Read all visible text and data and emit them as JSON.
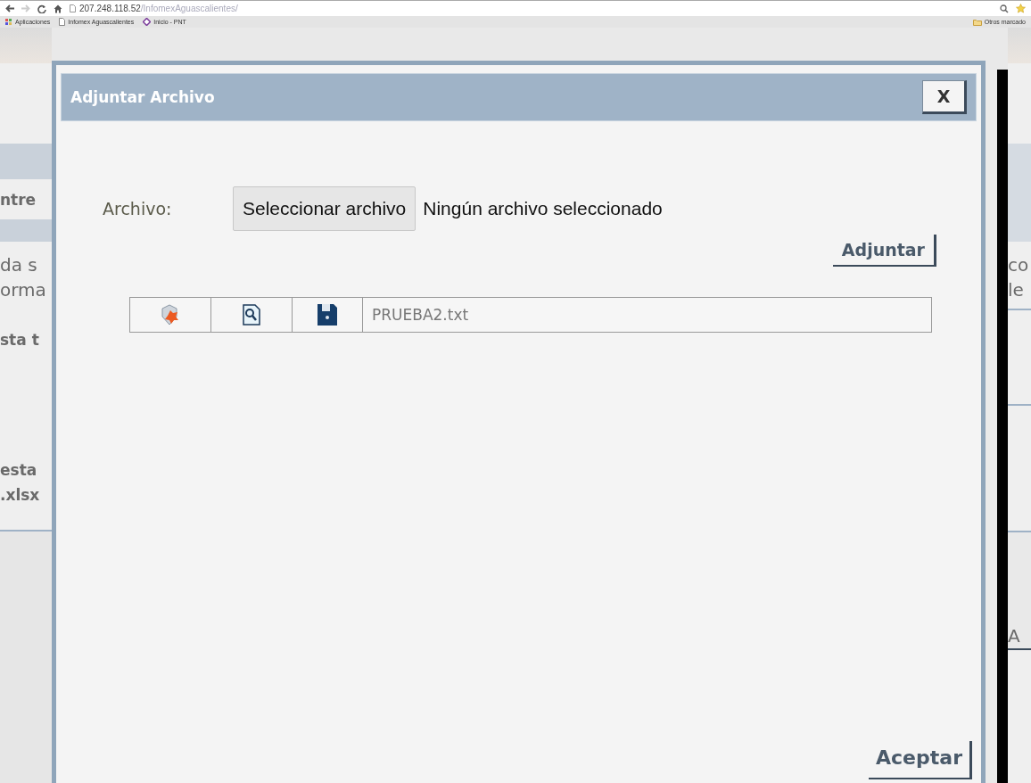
{
  "browser": {
    "url_host": "207.248.118.52",
    "url_path": "/InfomexAguascalientes/",
    "bookmarks": [
      {
        "label": "Aplicaciones",
        "kind": "apps"
      },
      {
        "label": "Infomex Aguascalientes",
        "kind": "page"
      },
      {
        "label": "Inicio - PNT",
        "kind": "site"
      }
    ],
    "other_bookmarks": "Otros marcado"
  },
  "background_page": {
    "left_fragments": [
      {
        "text": "ntre",
        "kind": "heading"
      },
      {
        "text": "da s",
        "kind": "body"
      },
      {
        "text": "orma",
        "kind": "body"
      },
      {
        "text": "sta t",
        "kind": "heading"
      },
      {
        "text": "esta",
        "kind": "heading"
      },
      {
        "text": ".xlsx",
        "kind": "heading"
      }
    ],
    "right_fragments": [
      {
        "text": "co"
      },
      {
        "text": "le"
      },
      {
        "text": "A"
      }
    ]
  },
  "dialog": {
    "title": "Adjuntar Archivo",
    "close": "X",
    "file_label": "Archivo:",
    "choose_button": "Seleccionar archivo",
    "no_file_text": "Ningún archivo seleccionado",
    "attach_button": "Adjuntar",
    "files": [
      {
        "name": "PRUEBA2.txt"
      }
    ],
    "accept_button": "Aceptar"
  }
}
